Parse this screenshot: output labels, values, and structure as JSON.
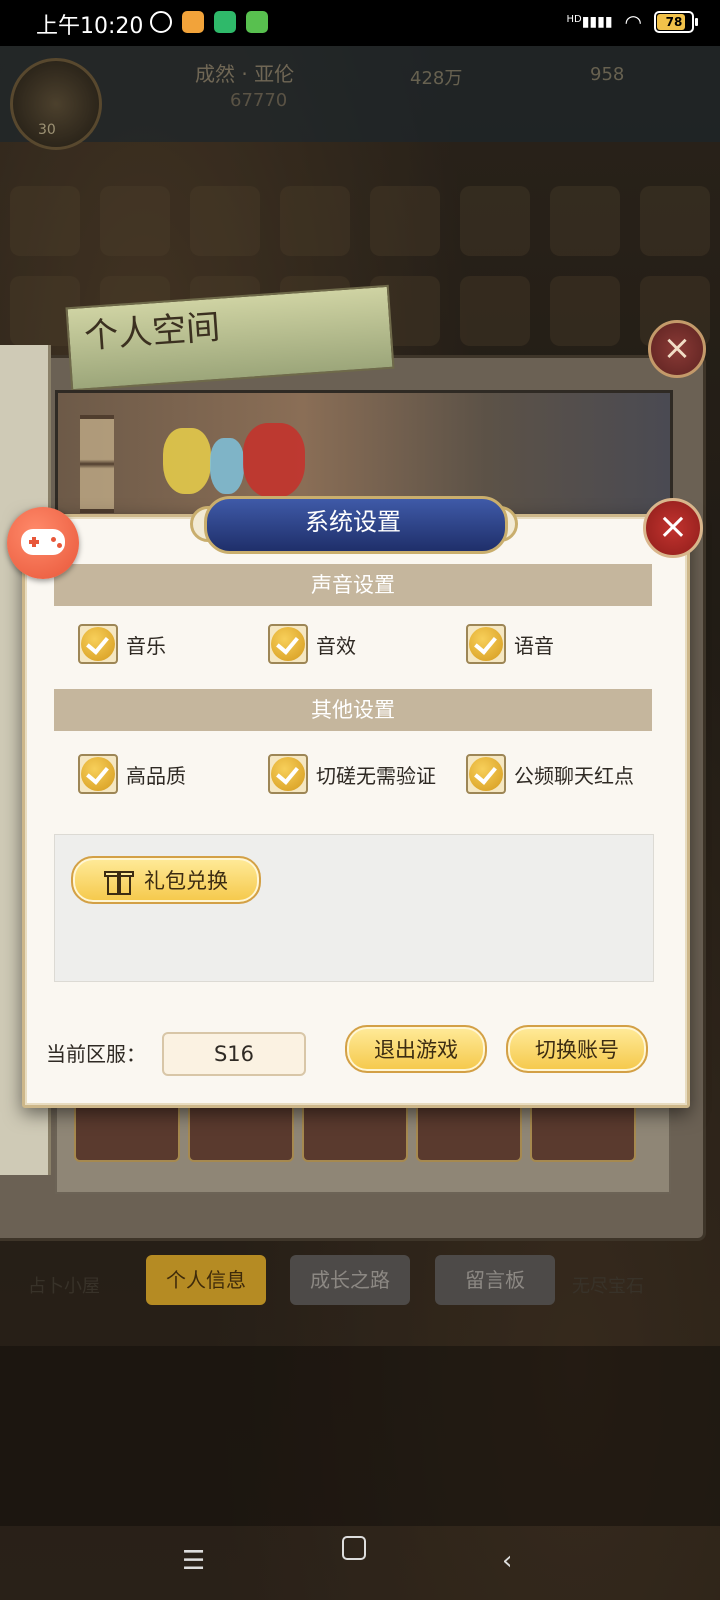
{
  "status_bar": {
    "time": "上午10:20",
    "battery": "78",
    "network": "HD"
  },
  "background": {
    "player_level": "30",
    "player_name": "成然 · 亚伦",
    "power": "67770",
    "gold": "428万",
    "gems": "958",
    "book_title": "个人空间",
    "tabs": [
      "个人信息",
      "成长之路",
      "留言板"
    ],
    "corner_labels": [
      "占卜小屋",
      "无尽宝石"
    ]
  },
  "dialog": {
    "title": "系统设置",
    "sound_section": "声音设置",
    "sound_options": [
      {
        "label": "音乐",
        "checked": true
      },
      {
        "label": "音效",
        "checked": true
      },
      {
        "label": "语音",
        "checked": true
      }
    ],
    "other_section": "其他设置",
    "other_options": [
      {
        "label": "高品质",
        "checked": true
      },
      {
        "label": "切磋无需验证",
        "checked": true
      },
      {
        "label": "公频聊天红点",
        "checked": true
      }
    ],
    "gift_button": "礼包兑换",
    "server_label": "当前区服：",
    "server_value": "S16",
    "exit_button": "退出游戏",
    "switch_button": "切换账号"
  },
  "colors": {
    "accent_gold": "#f5c84a",
    "title_blue": "#1f2f6a",
    "close_red": "#c2332f",
    "section_bar": "#c5b69d"
  }
}
